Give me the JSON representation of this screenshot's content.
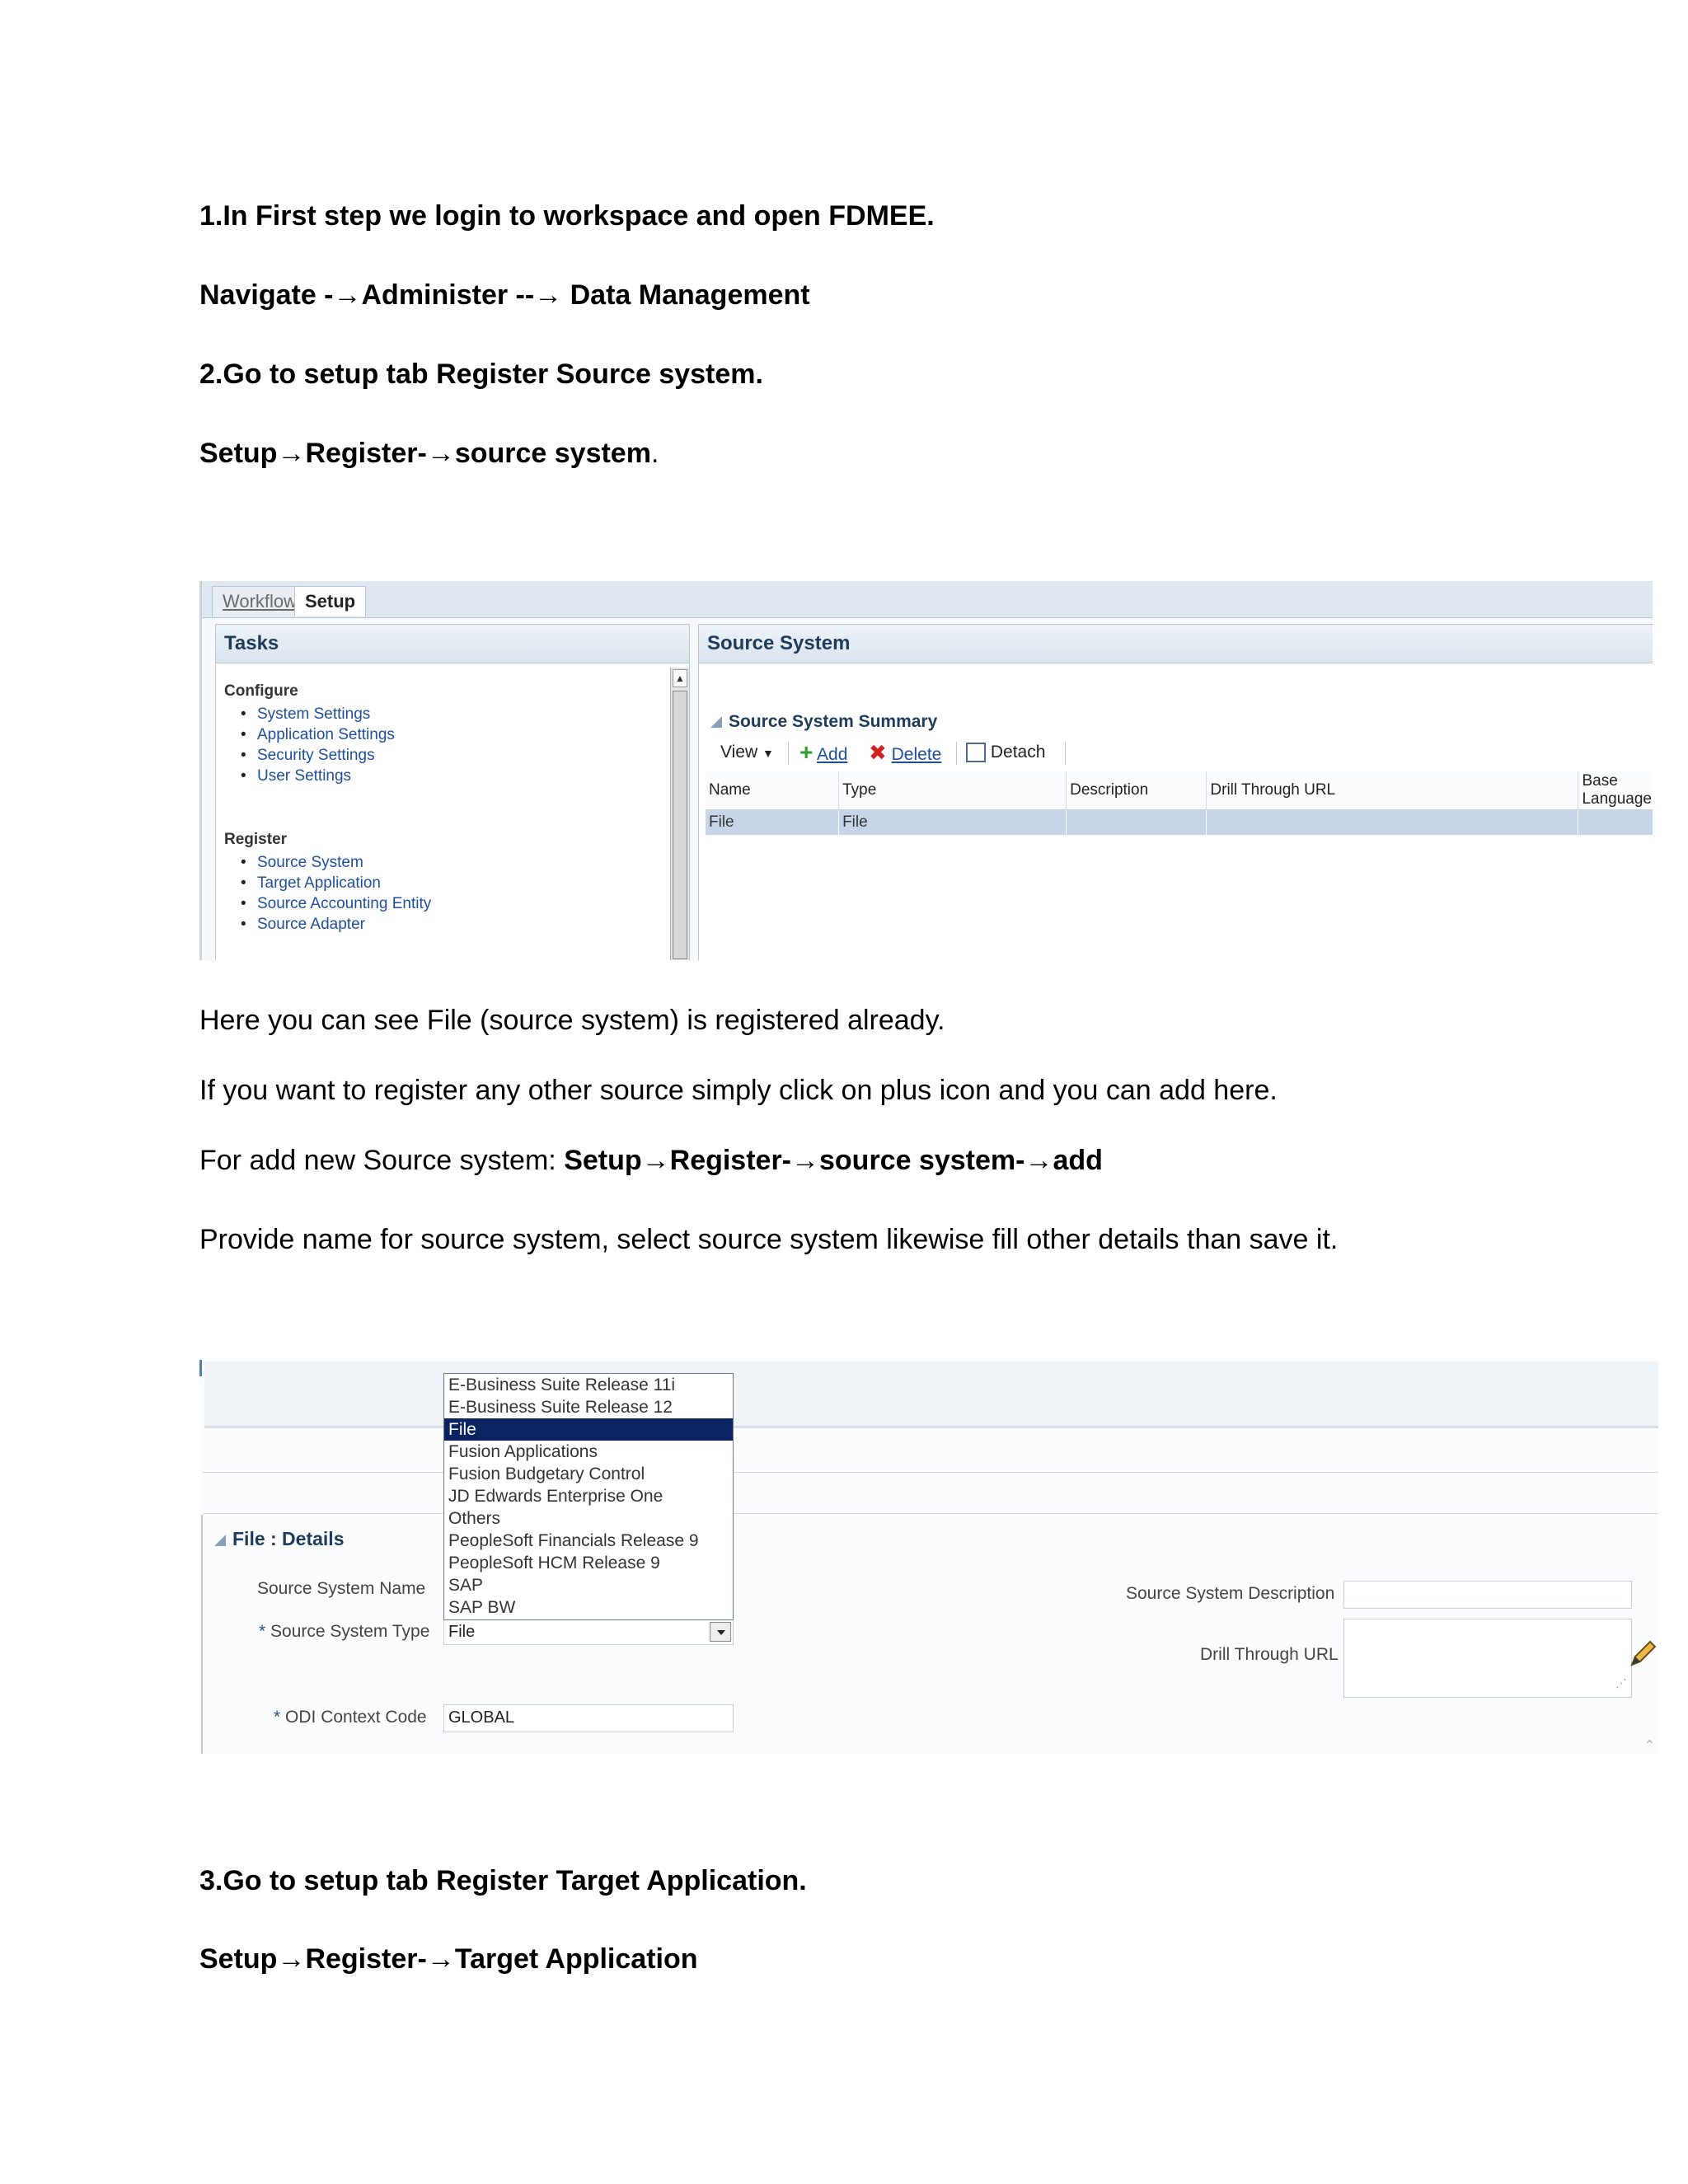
{
  "doc": {
    "step1_title": "1.In First step we login to workspace and open FDMEE.",
    "nav1": "Navigate -→Administer --→ Data Management",
    "step2_title": "2.Go to setup tab Register Source system.",
    "nav2_bold": "Setup→Register-→source system",
    "nav2_tail": ".",
    "note1": "Here you can see File (source system) is registered already.",
    "note2": "If you want to register any other source simply click on plus icon and you can add here.",
    "note3_prefix": "For add new Source system: ",
    "note3_bold": "Setup→Register-→source system-→add",
    "note4": "Provide name for source system, select source system likewise fill other details than save it.",
    "step3_title": "3.Go to setup tab Register Target Application.",
    "nav3": "Setup→Register-→Target Application"
  },
  "shot1": {
    "tabs": {
      "workflow": "Workflow",
      "setup": "Setup"
    },
    "tasks": {
      "title": "Tasks",
      "configure_heading": "Configure",
      "configure_items": [
        "System Settings",
        "Application Settings",
        "Security Settings",
        "User Settings"
      ],
      "register_heading": "Register",
      "register_items": [
        "Source System",
        "Target Application",
        "Source Accounting Entity",
        "Source Adapter"
      ]
    },
    "panel_title": "Source System",
    "summary_title": "Source System Summary",
    "toolbar": {
      "view": "View",
      "add": "Add",
      "delete": "Delete",
      "detach": "Detach"
    },
    "columns": [
      "Name",
      "Type",
      "Description",
      "Drill Through URL",
      "Base Language"
    ],
    "row": [
      "File",
      "File",
      "",
      "",
      ""
    ]
  },
  "shot2": {
    "dropdown_options": [
      "E-Business Suite Release 11i",
      "E-Business Suite Release 12",
      "File",
      "Fusion Applications",
      "Fusion Budgetary Control",
      "JD Edwards Enterprise One",
      "Others",
      "PeopleSoft Financials Release 9",
      "PeopleSoft HCM Release 9",
      "SAP",
      "SAP BW"
    ],
    "selected_option": "File",
    "details_title": "File : Details",
    "label_name": "Source System Name",
    "label_type": "Source System Type",
    "type_value": "File",
    "label_odi": "ODI Context Code",
    "odi_value": "GLOBAL",
    "label_desc": "Source System Description",
    "label_drill": "Drill Through URL",
    "required_mark": "*",
    "colors": {
      "selected_bg": "#0b2360",
      "link": "#1e4f9c",
      "header": "#1f3b5c"
    }
  }
}
